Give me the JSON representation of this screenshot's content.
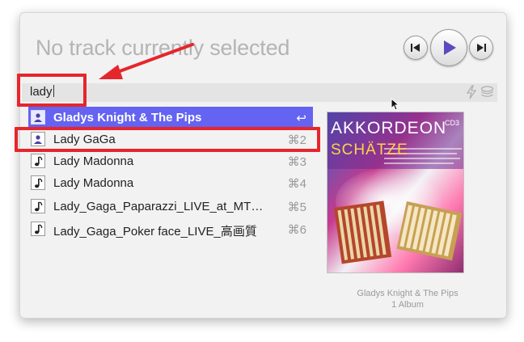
{
  "header": {
    "now_playing": "No track currently selected"
  },
  "controls": {
    "prev_icon": "skip-back-icon",
    "play_icon": "play-icon",
    "next_icon": "skip-forward-icon",
    "accent_color": "#5c4bbf"
  },
  "search": {
    "query": "lady",
    "icons": [
      "bolt-icon",
      "stack-icon"
    ]
  },
  "results": [
    {
      "label": "Gladys Knight & The Pips",
      "shortcut": "↩",
      "icon": "artist-icon",
      "selected": true
    },
    {
      "label": "Lady GaGa",
      "shortcut": "⌘2",
      "icon": "artist-icon",
      "selected": false
    },
    {
      "label": "Lady Madonna",
      "shortcut": "⌘3",
      "icon": "music-note-icon",
      "selected": false
    },
    {
      "label": "Lady Madonna",
      "shortcut": "⌘4",
      "icon": "music-note-icon",
      "selected": false
    },
    {
      "label": "Lady_Gaga_Paparazzi_LIVE_at_MT…",
      "shortcut": "⌘5",
      "icon": "music-note-icon",
      "selected": false
    },
    {
      "label": "Lady_Gaga_Poker face_LIVE_高画質",
      "shortcut": "⌘6",
      "icon": "music-note-icon",
      "selected": false
    }
  ],
  "album": {
    "title": "AKKORDEON",
    "subtitle": "SCHÄTZE",
    "badge": "CD3"
  },
  "details": {
    "artist": "Gladys Knight & The Pips",
    "count": "1 Album"
  },
  "highlight_color": "#e5262c",
  "selection_color": "#6463f2"
}
